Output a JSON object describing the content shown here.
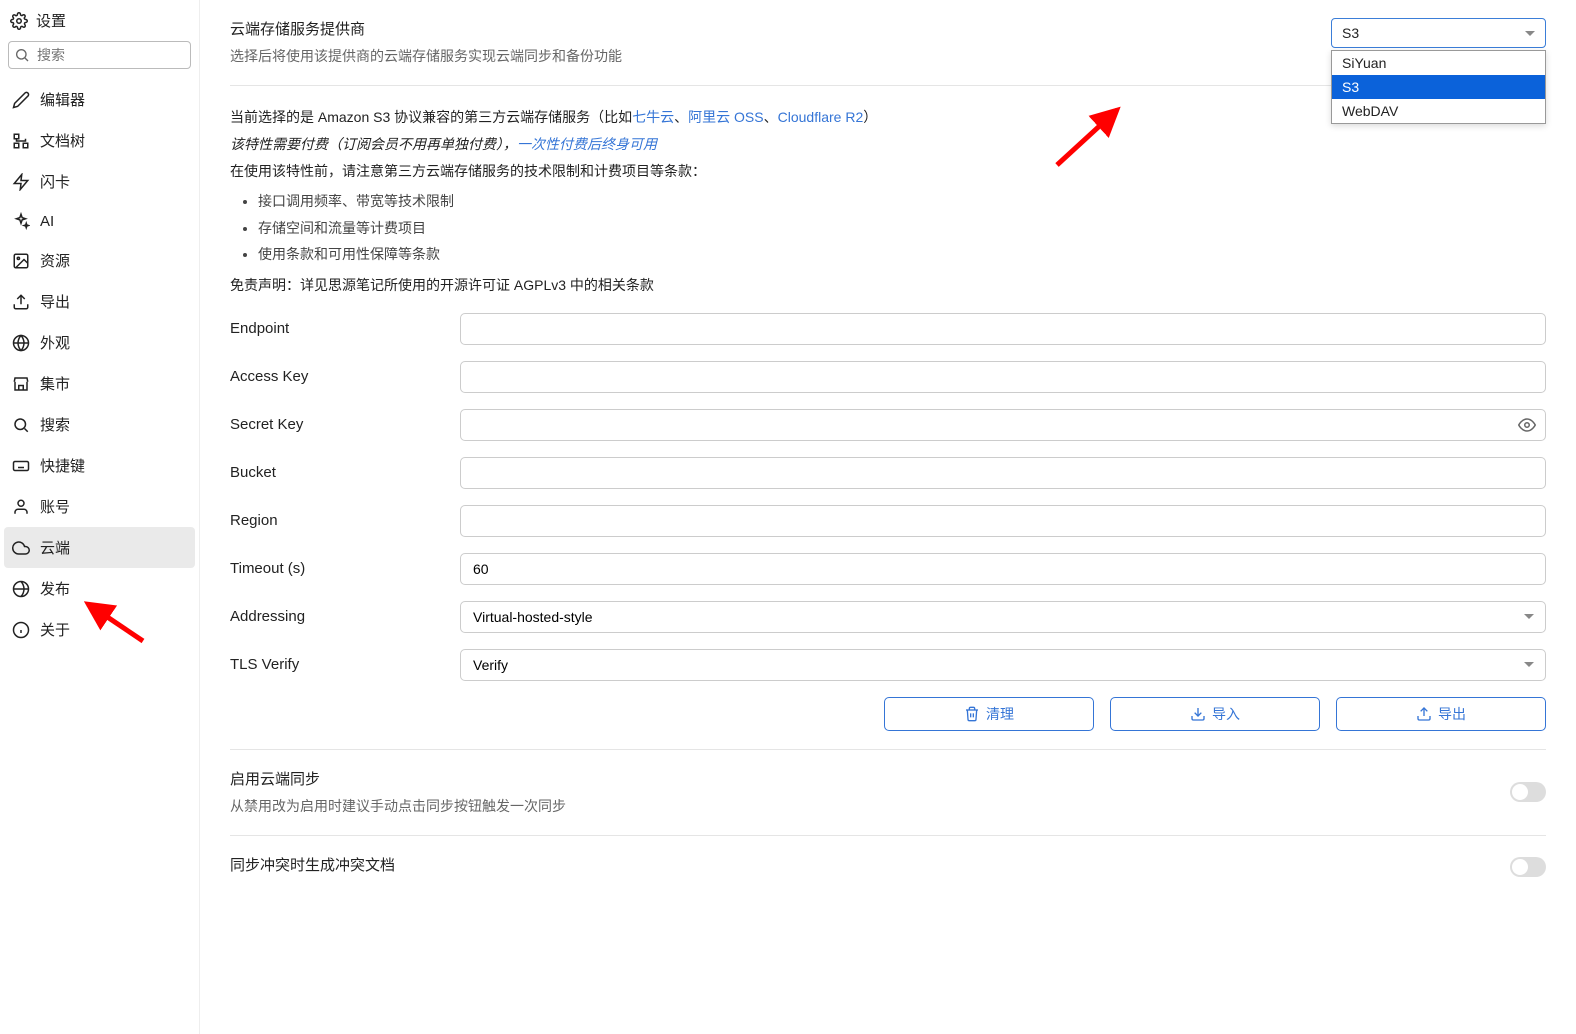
{
  "header": {
    "title": "设置"
  },
  "search": {
    "placeholder": "搜索"
  },
  "sidebar": {
    "items": [
      {
        "label": "编辑器",
        "id": "editor"
      },
      {
        "label": "文档树",
        "id": "doctree"
      },
      {
        "label": "闪卡",
        "id": "flashcard"
      },
      {
        "label": "AI",
        "id": "ai"
      },
      {
        "label": "资源",
        "id": "assets"
      },
      {
        "label": "导出",
        "id": "export"
      },
      {
        "label": "外观",
        "id": "appearance"
      },
      {
        "label": "集市",
        "id": "bazaar"
      },
      {
        "label": "搜索",
        "id": "search"
      },
      {
        "label": "快捷键",
        "id": "shortcuts"
      },
      {
        "label": "账号",
        "id": "account"
      },
      {
        "label": "云端",
        "id": "cloud"
      },
      {
        "label": "发布",
        "id": "publish"
      },
      {
        "label": "关于",
        "id": "about"
      }
    ]
  },
  "provider": {
    "title": "云端存储服务提供商",
    "desc": "选择后将使用该提供商的云端存储服务实现云端同步和备份功能",
    "selected": "S3",
    "options": [
      "SiYuan",
      "S3",
      "WebDAV"
    ]
  },
  "info": {
    "line1_prefix": "当前选择的是 Amazon S3 协议兼容的第三方云端存储服务（比如",
    "link1": "七牛云",
    "sep1": "、",
    "link2": "阿里云 OSS",
    "sep2": "、",
    "link3": "Cloudflare R2",
    "line1_suffix": "）",
    "line2_prefix": "该特性需要付费（订阅会员不用再单独付费），",
    "link4": "一次性付费后终身可用",
    "line3": "在使用该特性前，请注意第三方云端存储服务的技术限制和计费项目等条款：",
    "bullets": [
      "接口调用频率、带宽等技术限制",
      "存储空间和流量等计费项目",
      "使用条款和可用性保障等条款"
    ],
    "disclaimer": "免责声明：详见思源笔记所使用的开源许可证 AGPLv3 中的相关条款"
  },
  "form": {
    "endpoint": {
      "label": "Endpoint",
      "value": ""
    },
    "accesskey": {
      "label": "Access Key",
      "value": ""
    },
    "secretkey": {
      "label": "Secret Key",
      "value": ""
    },
    "bucket": {
      "label": "Bucket",
      "value": ""
    },
    "region": {
      "label": "Region",
      "value": ""
    },
    "timeout": {
      "label": "Timeout (s)",
      "value": "60"
    },
    "addressing": {
      "label": "Addressing",
      "value": "Virtual-hosted-style"
    },
    "tlsverify": {
      "label": "TLS Verify",
      "value": "Verify"
    }
  },
  "actions": {
    "clean": "清理",
    "import": "导入",
    "export": "导出"
  },
  "sync": {
    "title": "启用云端同步",
    "desc": "从禁用改为启用时建议手动点击同步按钮触发一次同步"
  },
  "conflict": {
    "title": "同步冲突时生成冲突文档"
  }
}
